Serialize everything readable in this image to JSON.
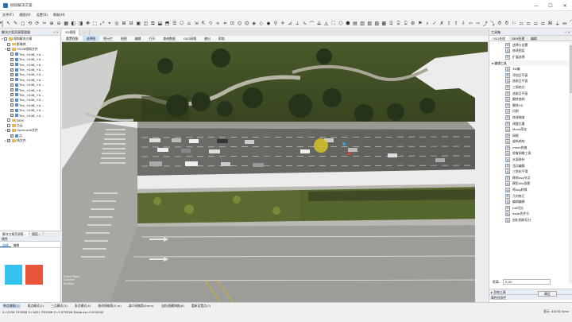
{
  "window": {
    "title": "倾斜解决方案",
    "min": "—",
    "max": "☐",
    "close": "✕"
  },
  "menu": [
    "文件(F)",
    "视图(V)",
    "设置(S)",
    "帮助(H)"
  ],
  "toolbar_icons": [
    "↖",
    "✎",
    "◻",
    "⟲",
    "⟳",
    "✂",
    "⊕",
    "⊖",
    "▦",
    "◧",
    "◨",
    "✥",
    "⬚",
    "⤢",
    "⌖",
    "◎",
    "⊞",
    "⊟",
    "▣",
    "◫",
    "⧉",
    "⬓",
    "⬒",
    "☰",
    "⎔",
    "⌂",
    "⇲",
    "⇱",
    "⟐",
    "⟡",
    "⌗",
    "⊡",
    "⌬",
    "⏣",
    "◈",
    "◇",
    "◆",
    "⚲",
    "✛",
    "⊿",
    "⟂",
    "∿",
    "⌒",
    "⟁",
    "◬",
    "⛶",
    "⬡",
    "⬢",
    "▤",
    "▥",
    "▧",
    "▨",
    "▩",
    "⌸",
    "⌹",
    "⌺",
    "⚙",
    "⚑",
    "⌕",
    "✓",
    "✗",
    "⇪",
    "⇧",
    "⇩",
    "⇦",
    "⇨",
    "⤴",
    "⤵",
    "⥀",
    "⥁",
    "⚐",
    "⚏",
    "⚎",
    "⚍",
    "⚌",
    "⌘",
    "⏚",
    "⏛",
    "⏜",
    "⏝"
  ],
  "left_panel": {
    "title": "解决方案资源管理器",
    "tree": [
      {
        "indent": 0,
        "tw": "▾",
        "cb": "",
        "icon": "folder",
        "label": "倾斜解决方案"
      },
      {
        "indent": 1,
        "tw": "",
        "cb": "",
        "icon": "folder",
        "label": "影像库"
      },
      {
        "indent": 1,
        "tw": "▾",
        "cb": "✓",
        "icon": "folder",
        "label": "OSGB倾斜文件"
      },
      {
        "indent": 2,
        "tw": "",
        "cb": "✓",
        "icon": "tile",
        "label": "Tile_+048_+0..."
      },
      {
        "indent": 2,
        "tw": "",
        "cb": "✓",
        "icon": "tile",
        "label": "Tile_+048_+0..."
      },
      {
        "indent": 2,
        "tw": "",
        "cb": "✓",
        "icon": "tile",
        "label": "Tile_+048_+0..."
      },
      {
        "indent": 2,
        "tw": "",
        "cb": "✓",
        "icon": "tile",
        "label": "Tile_+048_+0..."
      },
      {
        "indent": 2,
        "tw": "",
        "cb": "✓",
        "icon": "tile",
        "label": "Tile_+048_+0..."
      },
      {
        "indent": 2,
        "tw": "",
        "cb": "✓",
        "icon": "tile",
        "label": "Tile_+048_+0..."
      },
      {
        "indent": 2,
        "tw": "",
        "cb": "✓",
        "icon": "tile",
        "label": "Tile_+048_+0..."
      },
      {
        "indent": 2,
        "tw": "",
        "cb": "✓",
        "icon": "tile",
        "label": "Tile_+048_+0..."
      },
      {
        "indent": 2,
        "tw": "",
        "cb": "✓",
        "icon": "tile",
        "label": "Tile_+048_+0..."
      },
      {
        "indent": 2,
        "tw": "",
        "cb": "✓",
        "icon": "tile",
        "label": "Tile_+048_+0..."
      },
      {
        "indent": 2,
        "tw": "",
        "cb": "✓",
        "icon": "tile",
        "label": "Tile_+048_+0..."
      },
      {
        "indent": 2,
        "tw": "",
        "cb": "✓",
        "icon": "tile",
        "label": "Tile_+048_+0..."
      },
      {
        "indent": 2,
        "tw": "",
        "cb": "✓",
        "icon": "tile",
        "label": "Tile_+048_+0..."
      },
      {
        "indent": 1,
        "tw": "",
        "cb": "",
        "icon": "folder",
        "label": "DEM"
      },
      {
        "indent": 1,
        "tw": "",
        "cb": "",
        "icon": "folder",
        "label": "点云"
      },
      {
        "indent": 1,
        "tw": "▾",
        "cb": "✓",
        "icon": "folder",
        "label": "Openrode文件"
      },
      {
        "indent": 2,
        "tw": "",
        "cb": "✓",
        "icon": "tile",
        "label": "点"
      },
      {
        "indent": 1,
        "tw": "▸",
        "cb": "✓",
        "icon": "folder",
        "label": "线文件"
      }
    ],
    "panel_tabs": [
      "解决方案资源管...",
      "图层..."
    ],
    "sub_title": "属性",
    "sub_tabs": [
      "选择",
      "编辑"
    ],
    "swatch_colors": [
      "#35c2ef",
      "#e9553b"
    ]
  },
  "viewport": {
    "view_tabs": [
      "3D视图",
      "⋮"
    ],
    "ribbon_tabs": [
      "重置视角",
      "选择图",
      "图元栏",
      "视图",
      "编辑",
      "打开",
      "查询数据",
      "OSG网格",
      "输出",
      "帮助"
    ],
    "active_ribbon": 1,
    "coord_overlay": [
      "Frame Rate:",
      "Camera:",
      "Position:"
    ]
  },
  "right_panel": {
    "title": "工具箱",
    "tabs": [
      "OSG处理",
      "DEM处理",
      "编辑"
    ],
    "active_tab": 0,
    "tools": [
      {
        "type": "tool",
        "label": "选择与设置"
      },
      {
        "type": "tool",
        "label": "修改图层"
      },
      {
        "type": "tool",
        "label": "扩展选择"
      },
      {
        "type": "group",
        "label": "▾ 编辑工具"
      },
      {
        "type": "tool",
        "label": "3D编"
      },
      {
        "type": "tool",
        "label": "添加至平面"
      },
      {
        "type": "tool",
        "label": "选取至平面"
      },
      {
        "type": "tool",
        "label": "三角结分"
      },
      {
        "type": "tool",
        "label": "选取至平面"
      },
      {
        "type": "tool",
        "label": "翻转曲线"
      },
      {
        "type": "tool",
        "label": "删除OS"
      },
      {
        "type": "tool",
        "label": "切割"
      },
      {
        "type": "tool",
        "label": "修改缩放"
      },
      {
        "type": "tool",
        "label": "调整比重"
      },
      {
        "type": "tool",
        "label": "Mesh简化"
      },
      {
        "type": "tool",
        "label": "网格"
      },
      {
        "type": "tool",
        "label": "量纵结构"
      },
      {
        "type": "tool",
        "label": "mesh修复"
      },
      {
        "type": "tool",
        "label": "修复网格工具"
      },
      {
        "type": "tool",
        "label": "水面修补"
      },
      {
        "type": "tool",
        "label": "顶点编辑"
      },
      {
        "type": "tool",
        "label": "三角化平滑"
      },
      {
        "type": "tool",
        "label": "移除osg节点"
      },
      {
        "type": "tool",
        "label": "模型shp投影"
      },
      {
        "type": "tool",
        "label": "将osg转换"
      },
      {
        "type": "tool",
        "label": "几何修正"
      },
      {
        "type": "tool",
        "label": "编辑编辑"
      },
      {
        "type": "tool",
        "label": "tile切分"
      },
      {
        "type": "tool",
        "label": "osgb合并分"
      },
      {
        "type": "tool",
        "label": "剖析图斜切分"
      }
    ],
    "sub_title1": "▸ 总结工具",
    "sub_title2": "属性信息栏",
    "attr_label": "距离:",
    "attr_value": "0.00",
    "ok_label": "确定"
  },
  "mode_bar": [
    "单点捕捉(1)",
    "两点模式(2)",
    "三点模式(3)",
    "多点模式(4)",
    "修改网格简(5-m)",
    "减少网格简(5mm)",
    "当前/隐藏网格(6)",
    "重新设置点(7)"
  ],
  "status": {
    "coords": "X=2339.315580  Y=1621.750366  Z=3.079226  Distance=0.000000",
    "right": "显示:  40(30.5)ms"
  }
}
